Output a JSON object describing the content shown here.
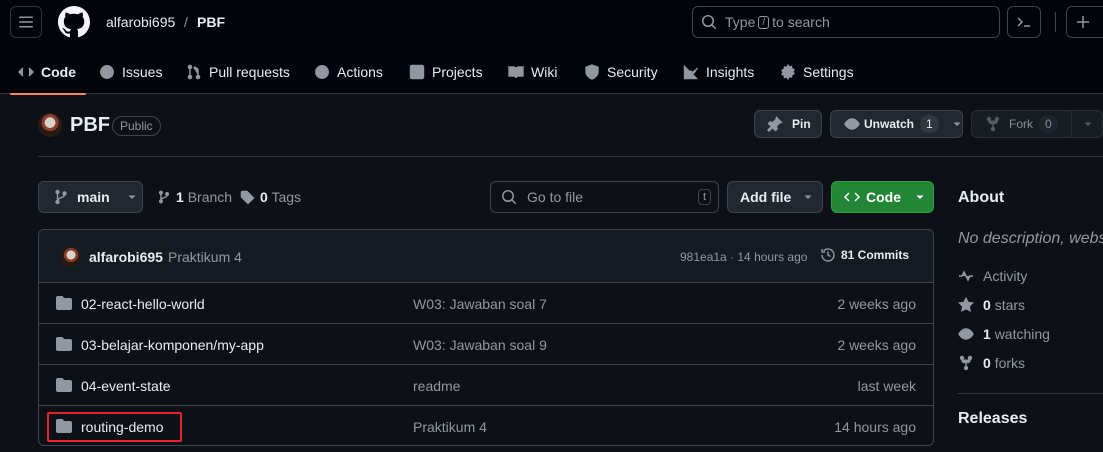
{
  "header": {
    "owner": "alfarobi695",
    "separator": "/",
    "repo": "PBF",
    "search": {
      "before": "Type",
      "key": "/",
      "after": "to search"
    }
  },
  "tabs": [
    {
      "label": "Code",
      "icon": "code-icon"
    },
    {
      "label": "Issues",
      "icon": "issue-icon"
    },
    {
      "label": "Pull requests",
      "icon": "pull-request-icon"
    },
    {
      "label": "Actions",
      "icon": "play-icon"
    },
    {
      "label": "Projects",
      "icon": "table-icon"
    },
    {
      "label": "Wiki",
      "icon": "book-icon"
    },
    {
      "label": "Security",
      "icon": "shield-icon"
    },
    {
      "label": "Insights",
      "icon": "graph-icon"
    },
    {
      "label": "Settings",
      "icon": "gear-icon"
    }
  ],
  "repo": {
    "name": "PBF",
    "visibility": "Public",
    "pin_label": "Pin",
    "watch_label": "Unwatch",
    "watch_count": "1",
    "fork_label": "Fork",
    "fork_count": "0"
  },
  "branch_bar": {
    "branch": "main",
    "branch_count": "1",
    "branch_label": "Branch",
    "tag_count": "0",
    "tag_label": "Tags",
    "goto_placeholder": "Go to file",
    "goto_key": "t",
    "add_file_label": "Add file",
    "code_label": "Code"
  },
  "last_commit": {
    "author": "alfarobi695",
    "message": "Praktikum 4",
    "hash_time": "981ea1a · 14 hours ago",
    "commits_label": "81 Commits"
  },
  "files": [
    {
      "name": "02-react-hello-world",
      "message": "W03: Jawaban soal 7",
      "date": "2 weeks ago"
    },
    {
      "name": "03-belajar-komponen/my-app",
      "message": "W03: Jawaban soal 9",
      "date": "2 weeks ago"
    },
    {
      "name": "04-event-state",
      "message": "readme",
      "date": "last week"
    },
    {
      "name": "routing-demo",
      "message": "Praktikum 4",
      "date": "14 hours ago"
    }
  ],
  "about": {
    "title": "About",
    "description": "No description, website",
    "activity": "Activity",
    "stars_count": "0",
    "stars_label": "stars",
    "watching_count": "1",
    "watching_label": "watching",
    "forks_count": "0",
    "forks_label": "forks",
    "releases_title": "Releases"
  },
  "colors": {
    "background": "#0d1117",
    "header": "#010409",
    "accent_green": "#238636",
    "tab_underline": "#f78166",
    "highlight_box": "#e5242b"
  }
}
